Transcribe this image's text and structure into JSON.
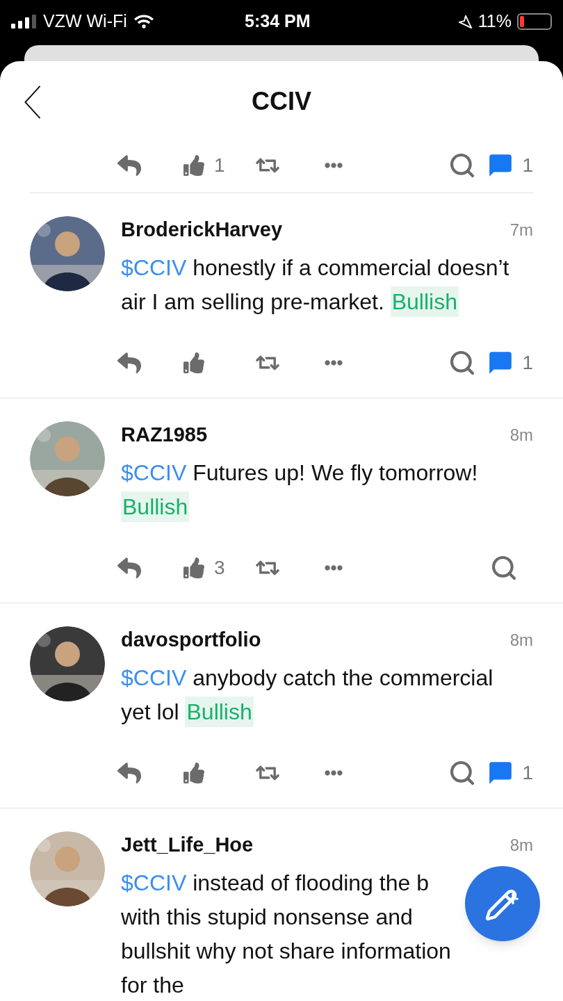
{
  "status_bar": {
    "carrier": "VZW Wi-Fi",
    "time": "5:34 PM",
    "battery": "11%"
  },
  "header": {
    "title": "CCIV"
  },
  "partial_actions": {
    "likes": "1",
    "comments": "1"
  },
  "posts": [
    {
      "username": "BroderickHarvey",
      "time": "7m",
      "ticker": "$CCIV",
      "body": "honestly if a commercial doesn’t air I am selling pre-market.",
      "sentiment": "Bullish",
      "actions": {
        "comments": "1"
      }
    },
    {
      "username": "RAZ1985",
      "time": "8m",
      "ticker": "$CCIV",
      "body": "Futures up! We fly tomorrow!",
      "sentiment": "Bullish",
      "actions": {
        "likes": "3"
      }
    },
    {
      "username": "davosportfolio",
      "time": "8m",
      "ticker": "$CCIV",
      "body": "anybody catch the commercial yet lol",
      "sentiment": "Bullish",
      "actions": {
        "comments": "1"
      }
    },
    {
      "username": "Jett_Life_Hoe",
      "time": "8m",
      "ticker": "$CCIV",
      "body": "instead of flooding the b with this stupid nonsense and bullshit why not share information for the"
    }
  ]
}
